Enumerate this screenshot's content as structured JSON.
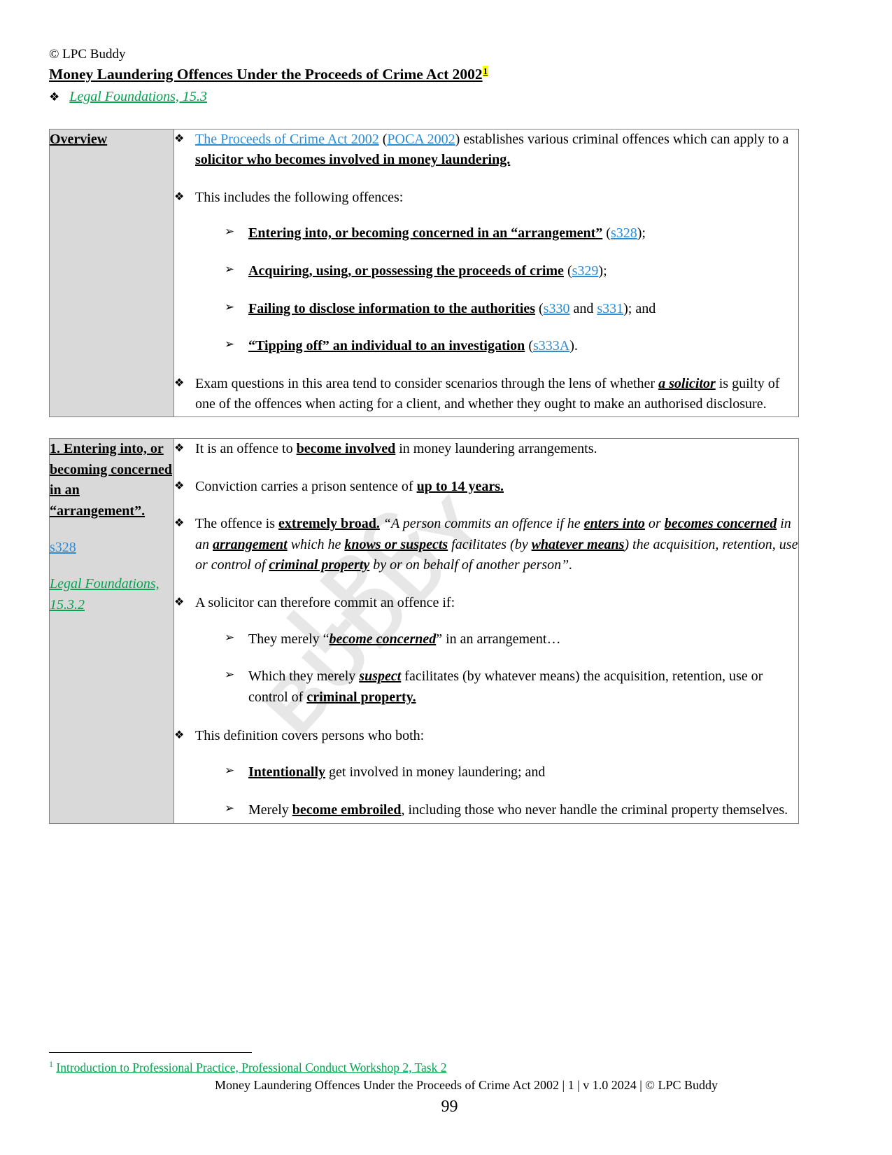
{
  "header": {
    "byline": "© LPC Buddy",
    "title": "Money Laundering Offences Under the Proceeds of Crime Act 2002",
    "footnote_marker": "1",
    "reference_bullet": "❖",
    "reference_link": "Legal Foundations, 15.3"
  },
  "colors": {
    "hyperlink_blue": "#2e8cd3",
    "green_link": "#00a550",
    "label_cell_bg": "#d9d9d9",
    "border": "#7f7f7f",
    "highlight_yellow": "#ffff00",
    "watermark": "#e7e7e7"
  },
  "watermark": {
    "line1": "LPC",
    "line2": "BUDDY"
  },
  "markers": {
    "diamond": "❖",
    "arrow": "➢"
  },
  "overview_table": {
    "label": "Overview",
    "bullets": {
      "b1": {
        "link1": "The Proceeds of Crime Act 2002",
        "mid1": " (",
        "link2": "POCA 2002",
        "mid2": ") establishes various criminal offences which can apply to a ",
        "bold_tail": "solicitor who becomes involved in money laundering."
      },
      "b2": "This includes the following offences:",
      "offences": [
        {
          "bold": "Entering into, or becoming concerned in an “arrangement”",
          "pre": " (",
          "link": "s328",
          "post": ");"
        },
        {
          "bold": "Acquiring, using, or possessing the proceeds of crime",
          "pre": " (",
          "link": "s329",
          "post": ");"
        },
        {
          "bold": "Failing to disclose information to the authorities",
          "pre": " (",
          "link": "s330",
          "mid": " and ",
          "link2": "s331",
          "post": "); and"
        },
        {
          "bold": "“Tipping off” an individual to an investigation",
          "pre": " (",
          "link": "s333A",
          "post": ")."
        }
      ],
      "b3": {
        "pre": "Exam questions in this area tend to consider scenarios through the lens of whether ",
        "emph": "a solicitor",
        "post": " is guilty of one of the offences when acting for a client, and whether they ought to make an authorised disclosure."
      }
    }
  },
  "section_table": {
    "label_heading": "1. Entering into, or becoming concerned in an “arrangement”.",
    "label_link": "s328",
    "label_green": "Legal Foundations, 15.3.2",
    "bullets": {
      "b1": {
        "pre": "It is an offence to ",
        "emph": "become involved",
        "post": " in money laundering arrangements."
      },
      "b2": {
        "pre": "Conviction carries a prison sentence of ",
        "emph": "up to 14 years."
      },
      "b3": {
        "pre": "The offence is ",
        "emph1": "extremely broad.",
        "q1": " “A person commits an offence if he ",
        "emph2": "enters into",
        "q2": " or ",
        "emph3": "becomes concerned",
        "q3": " in an ",
        "emph4": "arrangement",
        "q4": " which he ",
        "emph5": "knows or suspects",
        "q5": " facilitates (by ",
        "emph6": "whatever means",
        "q6": ") the acquisition, retention, use or control of ",
        "emph7": "criminal property",
        "q7": " by or on behalf of another person”."
      },
      "b4": "A solicitor can therefore commit an offence if:",
      "b4_sub": [
        {
          "pre": "They merely “",
          "emph": "become concerned",
          "post": "” in an arrangement…"
        },
        {
          "pre": "Which they merely ",
          "emph": "suspect",
          "post": " facilitates (by whatever means) the acquisition, retention, use or control of ",
          "emph2": "criminal property."
        }
      ],
      "b5": "This definition covers persons who both:",
      "b5_sub": [
        {
          "emph": "Intentionally",
          "post": " get involved in money laundering; and"
        },
        {
          "pre": "Merely ",
          "emph": "become embroiled",
          "post": ", including those who never handle the criminal property themselves."
        }
      ]
    }
  },
  "footnote": {
    "number": "1",
    "text": "Introduction to Professional Practice, Professional Conduct Workshop 2, Task 2"
  },
  "footer": {
    "text": "Money Laundering Offences Under the Proceeds of Crime Act 2002 | 1 | v 1.0 2024 | © LPC Buddy",
    "page_number": "99"
  }
}
